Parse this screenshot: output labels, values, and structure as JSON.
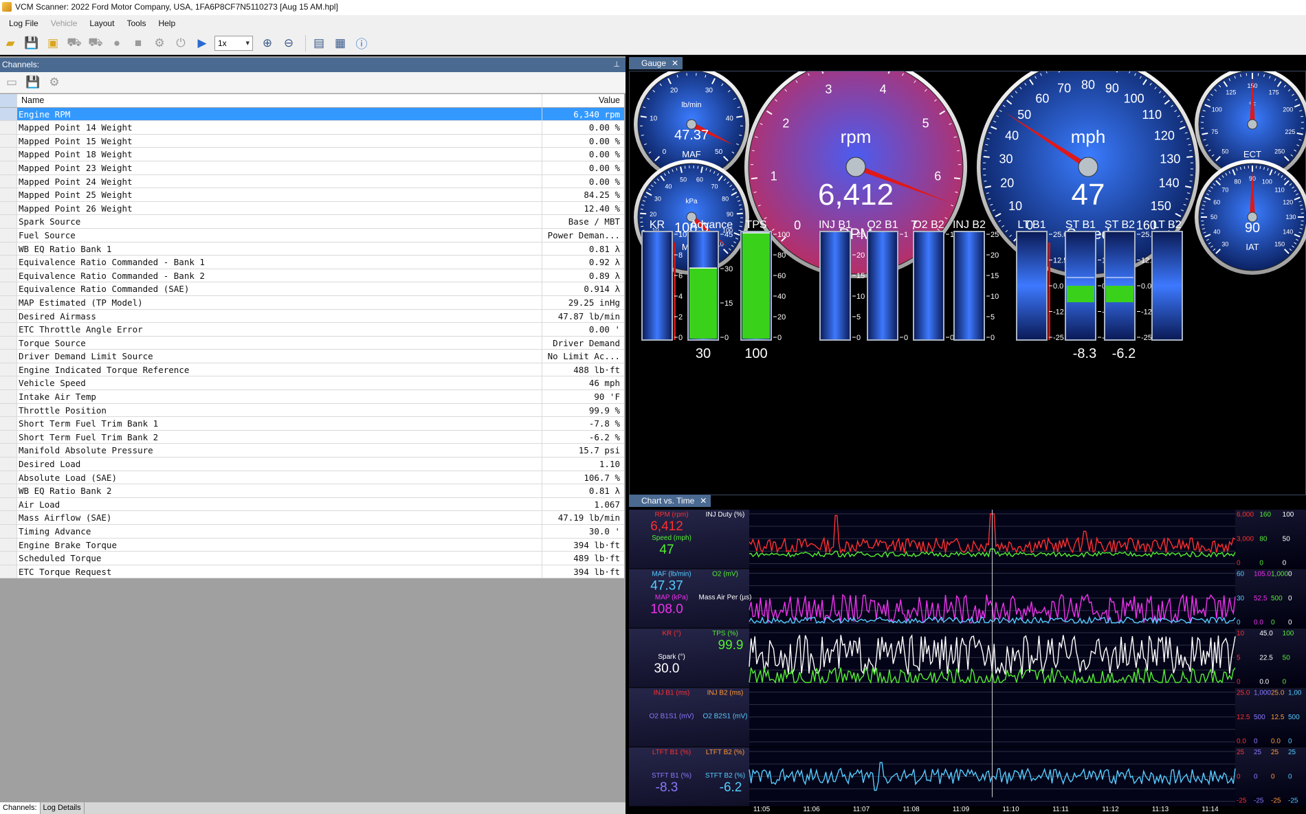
{
  "window": {
    "title": "VCM Scanner: 2022 Ford Motor Company, USA, 1FA6P8CF7N5110273 [Aug 15 AM.hpl]"
  },
  "menu": {
    "items": [
      "Log File",
      "Vehicle",
      "Layout",
      "Tools",
      "Help"
    ]
  },
  "toolbar": {
    "playback_speed": "1x"
  },
  "channels_panel": {
    "title": "Channels:",
    "columns": {
      "name": "Name",
      "value": "Value"
    },
    "rows": [
      {
        "name": "Engine RPM",
        "value": "6,340 rpm"
      },
      {
        "name": "Mapped Point 14 Weight",
        "value": "0.00 %"
      },
      {
        "name": "Mapped Point 15 Weight",
        "value": "0.00 %"
      },
      {
        "name": "Mapped Point 18 Weight",
        "value": "0.00 %"
      },
      {
        "name": "Mapped Point 23 Weight",
        "value": "0.00 %"
      },
      {
        "name": "Mapped Point 24 Weight",
        "value": "0.00 %"
      },
      {
        "name": "Mapped Point 25 Weight",
        "value": "84.25 %"
      },
      {
        "name": "Mapped Point 26 Weight",
        "value": "12.40 %"
      },
      {
        "name": "Spark Source",
        "value": "Base / MBT"
      },
      {
        "name": "Fuel Source",
        "value": "Power Deman..."
      },
      {
        "name": "WB EQ Ratio Bank 1",
        "value": "0.81 λ"
      },
      {
        "name": "Equivalence Ratio Commanded - Bank 1",
        "value": "0.92 λ"
      },
      {
        "name": "Equivalence Ratio Commanded - Bank 2",
        "value": "0.89 λ"
      },
      {
        "name": "Equivalence Ratio Commanded (SAE)",
        "value": "0.914 λ"
      },
      {
        "name": "MAP Estimated (TP Model)",
        "value": "29.25 inHg"
      },
      {
        "name": "Desired Airmass",
        "value": "47.87 lb/min"
      },
      {
        "name": "ETC Throttle Angle Error",
        "value": "0.00 '"
      },
      {
        "name": "Torque Source",
        "value": "Driver Demand"
      },
      {
        "name": "Driver Demand Limit Source",
        "value": "No Limit Ac..."
      },
      {
        "name": "Engine Indicated Torque Reference",
        "value": "488 lb·ft"
      },
      {
        "name": "Vehicle Speed",
        "value": "46 mph"
      },
      {
        "name": "Intake Air Temp",
        "value": "90 'F"
      },
      {
        "name": "Throttle Position",
        "value": "99.9 %"
      },
      {
        "name": "Short Term Fuel Trim Bank 1",
        "value": "-7.8 %"
      },
      {
        "name": "Short Term Fuel Trim Bank 2",
        "value": "-6.2 %"
      },
      {
        "name": "Manifold Absolute Pressure",
        "value": "15.7 psi"
      },
      {
        "name": "Desired Load",
        "value": "1.10"
      },
      {
        "name": "Absolute Load (SAE)",
        "value": "106.7 %"
      },
      {
        "name": "WB EQ Ratio Bank 2",
        "value": "0.81 λ"
      },
      {
        "name": "Air Load",
        "value": "1.067"
      },
      {
        "name": "Mass Airflow (SAE)",
        "value": "47.19 lb/min"
      },
      {
        "name": "Timing Advance",
        "value": "30.0 '"
      },
      {
        "name": "Engine Brake Torque",
        "value": "394 lb·ft"
      },
      {
        "name": "Scheduled Torque",
        "value": "489 lb·ft"
      },
      {
        "name": "ETC Torque Request",
        "value": "394 lb·ft"
      }
    ],
    "tabs": [
      "Channels:",
      "Log Details"
    ]
  },
  "gauge_tab": {
    "label": "Gauge"
  },
  "chart_tab": {
    "label": "Chart vs. Time"
  },
  "gauges": {
    "maf": {
      "unit": "lb/min",
      "value": "47.37",
      "name": "MAF",
      "ticks": [
        "0",
        "10",
        "20",
        "30",
        "40",
        "50"
      ]
    },
    "map": {
      "unit": "kPa",
      "value": "108.0",
      "name": "MAP",
      "ticks": [
        "0",
        "10",
        "20",
        "30",
        "40",
        "50",
        "60",
        "70",
        "80",
        "90",
        "100",
        "110"
      ]
    },
    "rpm": {
      "unit": "rpm",
      "value": "6,412",
      "name": "RPM",
      "ticks": [
        "0",
        "1",
        "2",
        "3",
        "4",
        "5",
        "6",
        "7"
      ]
    },
    "speed": {
      "unit": "mph",
      "value": "47",
      "name": "Speed",
      "ticks": [
        "0",
        "10",
        "20",
        "30",
        "40",
        "50",
        "60",
        "70",
        "80",
        "90",
        "100",
        "110",
        "120",
        "130",
        "140",
        "150",
        "160"
      ]
    },
    "ect": {
      "unit": "°F",
      "name": "ECT",
      "ticks": [
        "50",
        "75",
        "100",
        "125",
        "150",
        "175",
        "200",
        "225",
        "250"
      ]
    },
    "iat": {
      "value": "90",
      "name": "IAT",
      "ticks": [
        "30",
        "40",
        "50",
        "60",
        "70",
        "80",
        "90",
        "100",
        "110",
        "120",
        "130",
        "140",
        "150"
      ]
    }
  },
  "bars": [
    {
      "label": "KR",
      "ticks": [
        "10",
        "8",
        "6",
        "4",
        "2",
        "0"
      ],
      "fill": 0,
      "value": ""
    },
    {
      "label": "Advance",
      "ticks": [
        "45",
        "30",
        "15",
        "0"
      ],
      "fill": 0.667,
      "value": "30"
    },
    {
      "label": "TPS",
      "ticks": [
        "100",
        "80",
        "60",
        "40",
        "20",
        "0"
      ],
      "fill": 1.0,
      "value": "100"
    },
    {
      "label": "INJ B1",
      "ticks": [
        "25",
        "20",
        "15",
        "10",
        "5",
        "0"
      ],
      "fill": 0,
      "value": ""
    },
    {
      "label": "O2 B1",
      "ticks": [
        "1",
        "0"
      ],
      "fill": 0,
      "value": ""
    },
    {
      "label": "O2 B2",
      "ticks": [
        "1",
        "0"
      ],
      "fill": 0,
      "value": ""
    },
    {
      "label": "INJ B2",
      "ticks": [
        "25",
        "20",
        "15",
        "10",
        "5",
        "0"
      ],
      "fill": 0,
      "value": ""
    },
    {
      "label": "LT B1",
      "ticks": [
        "25.0",
        "12.5",
        "0.0",
        "-12.",
        "-25."
      ],
      "center": true,
      "fill": 0,
      "value": ""
    },
    {
      "label": "ST B1",
      "ticks": [
        "25.0",
        "12.5",
        "0.0",
        "-12.",
        "-25."
      ],
      "center": true,
      "fill": -0.33,
      "value": "-8.3"
    },
    {
      "label": "ST B2",
      "ticks": [
        "25.0",
        "12.5",
        "0.0",
        "-12.",
        "-25."
      ],
      "center": true,
      "fill": -0.25,
      "value": "-6.2"
    },
    {
      "label": "LT B2",
      "ticks": [],
      "center": true,
      "fill": 0,
      "value": ""
    }
  ],
  "chart_data": {
    "type": "line",
    "x_labels": [
      "11:05",
      "11:06",
      "11:07",
      "11:08",
      "11:09",
      "11:10",
      "11:11",
      "11:12",
      "11:13",
      "11:14"
    ],
    "panes": [
      {
        "left": [
          {
            "label": "RPM (rpm)",
            "value": "6,412",
            "color": "#ff3030"
          },
          {
            "label": "Speed (mph)",
            "value": "47",
            "color": "#55ee33"
          }
        ],
        "mid": [
          {
            "label": "INJ Duty (%)",
            "color": "#ffffff"
          }
        ],
        "right": [
          {
            "text": "6,000",
            "color": "#ff3030"
          },
          {
            "text": "160",
            "color": "#55ee33"
          },
          {
            "text": "100",
            "color": "#ffffff"
          },
          {
            "text": "3,000",
            "color": "#ff3030"
          },
          {
            "text": "80",
            "color": "#55ee33"
          },
          {
            "text": "50",
            "color": "#ffffff"
          },
          {
            "text": "0",
            "color": "#ff3030"
          },
          {
            "text": "0",
            "color": "#55ee33"
          },
          {
            "text": "0",
            "color": "#ffffff"
          }
        ]
      },
      {
        "left": [
          {
            "label": "MAF (lb/min)",
            "value": "47.37",
            "color": "#55ccff"
          },
          {
            "label": "MAP (kPa)",
            "value": "108.0",
            "color": "#ee33ee"
          }
        ],
        "mid": [
          {
            "label": "O2 (mV)",
            "color": "#55ee33"
          },
          {
            "label": "Mass Air Per (µs)",
            "color": "#ffffff"
          }
        ],
        "right": [
          {
            "text": "60",
            "color": "#55ccff"
          },
          {
            "text": "105.0",
            "color": "#ee33ee"
          },
          {
            "text": "1,000",
            "color": "#55ee33"
          },
          {
            "text": "0",
            "color": "#ffffff"
          },
          {
            "text": "30",
            "color": "#55ccff"
          },
          {
            "text": "52.5",
            "color": "#ee33ee"
          },
          {
            "text": "500",
            "color": "#55ee33"
          },
          {
            "text": "0",
            "color": "#ffffff"
          },
          {
            "text": "0",
            "color": "#55ccff"
          },
          {
            "text": "0.0",
            "color": "#ee33ee"
          },
          {
            "text": "0",
            "color": "#55ee33"
          },
          {
            "text": "0",
            "color": "#ffffff"
          }
        ]
      },
      {
        "left": [
          {
            "label": "KR (°)",
            "value": "",
            "color": "#ff3030"
          },
          {
            "label": "Spark (°)",
            "value": "30.0",
            "color": "#ffffff"
          }
        ],
        "mid": [
          {
            "label": "TPS (%)",
            "value": "99.9",
            "color": "#55ee33"
          }
        ],
        "right": [
          {
            "text": "10",
            "color": "#ff3030"
          },
          {
            "text": "45.0",
            "color": "#ffffff"
          },
          {
            "text": "100",
            "color": "#55ee33"
          },
          {
            "text": "5",
            "color": "#ff3030"
          },
          {
            "text": "22.5",
            "color": "#ffffff"
          },
          {
            "text": "50",
            "color": "#55ee33"
          },
          {
            "text": "0",
            "color": "#ff3030"
          },
          {
            "text": "0.0",
            "color": "#ffffff"
          },
          {
            "text": "0",
            "color": "#55ee33"
          }
        ]
      },
      {
        "left": [
          {
            "label": "INJ B1 (ms)",
            "value": "",
            "color": "#ff3030"
          },
          {
            "label": "O2 B1S1 (mV)",
            "value": "",
            "color": "#8a7aff"
          }
        ],
        "mid": [
          {
            "label": "INJ B2 (ms)",
            "color": "#ff9933"
          },
          {
            "label": "O2 B2S1 (mV)",
            "color": "#55ccff"
          }
        ],
        "right": [
          {
            "text": "25.0",
            "color": "#ff3030"
          },
          {
            "text": "1,000",
            "color": "#8a7aff"
          },
          {
            "text": "25.0",
            "color": "#ff9933"
          },
          {
            "text": "1,00",
            "color": "#55ccff"
          },
          {
            "text": "12.5",
            "color": "#ff3030"
          },
          {
            "text": "500",
            "color": "#8a7aff"
          },
          {
            "text": "12.5",
            "color": "#ff9933"
          },
          {
            "text": "500",
            "color": "#55ccff"
          },
          {
            "text": "0.0",
            "color": "#ff3030"
          },
          {
            "text": "0",
            "color": "#8a7aff"
          },
          {
            "text": "0.0",
            "color": "#ff9933"
          },
          {
            "text": "0",
            "color": "#55ccff"
          }
        ]
      },
      {
        "left": [
          {
            "label": "LTFT B1 (%)",
            "value": "",
            "color": "#ff3030"
          },
          {
            "label": "STFT B1 (%)",
            "value": "-8.3",
            "color": "#8a7aff"
          }
        ],
        "mid": [
          {
            "label": "LTFT B2 (%)",
            "color": "#ff9933"
          },
          {
            "label": "STFT B2 (%)",
            "value": "-6.2",
            "color": "#55ccff"
          }
        ],
        "right": [
          {
            "text": "25",
            "color": "#ff3030"
          },
          {
            "text": "25",
            "color": "#8a7aff"
          },
          {
            "text": "25",
            "color": "#ff9933"
          },
          {
            "text": "25",
            "color": "#55ccff"
          },
          {
            "text": "0",
            "color": "#ff3030"
          },
          {
            "text": "0",
            "color": "#8a7aff"
          },
          {
            "text": "0",
            "color": "#ff9933"
          },
          {
            "text": "0",
            "color": "#55ccff"
          },
          {
            "text": "-25",
            "color": "#ff3030"
          },
          {
            "text": "-25",
            "color": "#8a7aff"
          },
          {
            "text": "-25",
            "color": "#ff9933"
          },
          {
            "text": "-25",
            "color": "#55ccff"
          }
        ]
      }
    ],
    "series": [
      {
        "name": "RPM (rpm)",
        "pane": 0,
        "range": [
          0,
          6000
        ],
        "color": "#ff3030",
        "base": 2200,
        "noise": 900,
        "spikes": [
          [
            0.18,
            5800
          ],
          [
            0.5,
            6400
          ],
          [
            0.69,
            3900
          ]
        ]
      },
      {
        "name": "Speed (mph)",
        "pane": 0,
        "range": [
          0,
          160
        ],
        "color": "#55ee33",
        "base": 30,
        "noise": 8,
        "spikes": [
          [
            0.18,
            40
          ],
          [
            0.5,
            47
          ]
        ]
      },
      {
        "name": "MAP (kPa)",
        "pane": 1,
        "range": [
          0,
          105
        ],
        "color": "#ee33ee",
        "base": 30,
        "noise": 30,
        "spikes": []
      },
      {
        "name": "MAF (lb/min)",
        "pane": 1,
        "range": [
          0,
          60
        ],
        "color": "#55ccff",
        "base": 3,
        "noise": 4,
        "spikes": []
      },
      {
        "name": "Spark (°)",
        "pane": 2,
        "range": [
          0,
          45
        ],
        "color": "#ffffff",
        "base": 25,
        "noise": 18,
        "spikes": []
      },
      {
        "name": "TPS (%)",
        "pane": 2,
        "range": [
          0,
          100
        ],
        "color": "#55ee33",
        "base": 10,
        "noise": 20,
        "spikes": []
      },
      {
        "name": "STFT B1 (%)",
        "pane": 4,
        "range": [
          -25,
          25
        ],
        "color": "#55ccff",
        "base": 0,
        "noise": 8,
        "spikes": [
          [
            0.26,
            -14
          ],
          [
            0.27,
            14
          ]
        ]
      }
    ],
    "cursor_x_fraction": 0.5
  },
  "colors": {
    "accent": "#3399ff",
    "panel_header": "#4a6a92",
    "rpm_face": "#c82f5a",
    "gauge_face": "#1a4ab0"
  }
}
